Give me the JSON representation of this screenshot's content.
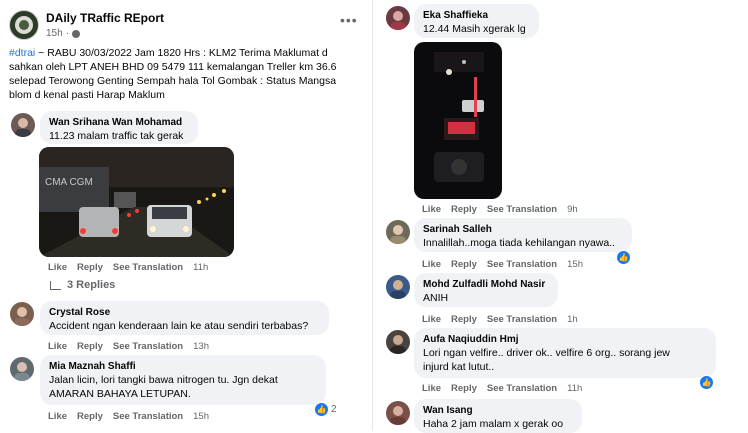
{
  "post": {
    "page_name": "DAily TRaffic REport",
    "time": "15h",
    "more": "•••",
    "hashtag": "#dtrai",
    "text": " ~ RABU 30/03/2022 Jam 1820 Hrs : KLM2 Terima Maklumat d sahkan oleh LPT ANEH BHD 09 5479 111 kemalangan Treller km 36.6 selepad Terowong Genting Sempah hala Tol Gombak : Status Mangsa blom d kenal pasti Harap Maklum"
  },
  "actions": {
    "like": "Like",
    "reply": "Reply",
    "translate": "See Translation"
  },
  "left_comments": [
    {
      "name": "Wan Srihana Wan Mohamad",
      "text": "11.23 malam traffic tak gerak",
      "time": "11h",
      "photo_text": "CMA CGM",
      "replies": "3 Replies"
    },
    {
      "name": "Crystal Rose",
      "text": "Accident ngan kenderaan lain ke atau sendiri terbabas?",
      "time": "13h"
    },
    {
      "name": "Mia Maznah Shaffi",
      "text1": "Jalan licin, lori tangki bawa nitrogen tu. Jgn dekat",
      "text2": "AMARAN BAHAYA LETUPAN.",
      "time": "15h",
      "reactions": "2"
    }
  ],
  "right_comments": [
    {
      "name": "Eka Shaffieka",
      "text": "12.44 Masih xgerak lg",
      "time": "9h"
    },
    {
      "name": "Sarinah Salleh",
      "text": "Innalillah..moga tiada kehilangan nyawa..",
      "time": "15h"
    },
    {
      "name": "Mohd Zulfadli Mohd Nasir",
      "text": "ANIH",
      "time": "1h"
    },
    {
      "name": "Aufa Naqiuddin Hmj",
      "text1": "Lori ngan velfire.. driver ok.. velfire 6 org.. sorang jew",
      "text2": "injurd kat lutut..",
      "time": "11h"
    },
    {
      "name": "Wan Isang",
      "text": "Haha 2 jam malam x gerak oo"
    }
  ],
  "icons": {
    "like_badge": "thumbs-up-icon",
    "globe": "globe-icon"
  },
  "colors": {
    "like_blue": "#1877f2",
    "hashtag": "#216fdb",
    "bubble": "#f0f2f5"
  }
}
